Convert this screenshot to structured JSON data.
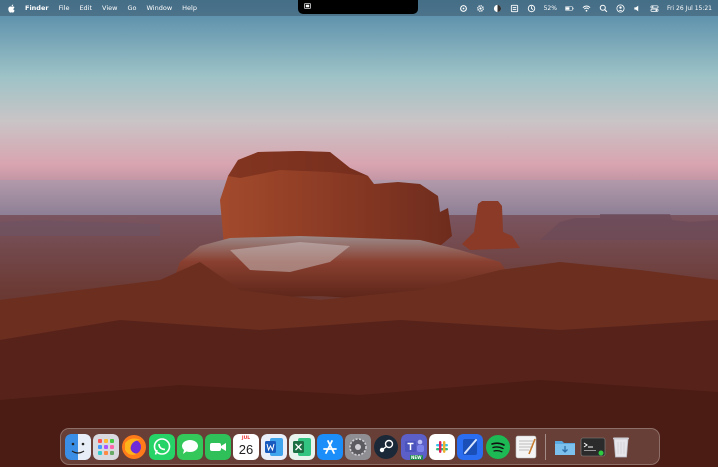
{
  "menubar": {
    "app_name": "Finder",
    "items": [
      "File",
      "Edit",
      "View",
      "Go",
      "Window",
      "Help"
    ],
    "battery_percent": "52%",
    "datetime": "Fri 26 Jul  15:21",
    "status_icons": [
      "screen-record-icon",
      "settings-icon",
      "dark-mode-icon",
      "clipboard-icon",
      "timer-icon",
      "battery-icon",
      "wifi-icon",
      "search-icon",
      "user-icon",
      "volume-icon",
      "control-center-icon"
    ]
  },
  "dock": {
    "apps": [
      {
        "name": "Finder",
        "icon": "finder-icon",
        "color": "#3a8ee6"
      },
      {
        "name": "Launchpad",
        "icon": "launchpad-icon",
        "color": "#d9d9e0"
      },
      {
        "name": "Firefox",
        "icon": "firefox-icon",
        "color": "#ff7a1a"
      },
      {
        "name": "WhatsApp",
        "icon": "whatsapp-icon",
        "color": "#25d366"
      },
      {
        "name": "Messages",
        "icon": "messages-icon",
        "color": "#34c759"
      },
      {
        "name": "FaceTime",
        "icon": "facetime-icon",
        "color": "#2fc05a"
      },
      {
        "name": "Calendar",
        "icon": "calendar-icon",
        "month": "JUL",
        "day": "26"
      },
      {
        "name": "Word",
        "icon": "word-icon",
        "color": "#185abd"
      },
      {
        "name": "Excel",
        "icon": "excel-icon",
        "color": "#1d7044"
      },
      {
        "name": "App Store",
        "icon": "app-store-icon",
        "color": "#1c8ef9"
      },
      {
        "name": "System Settings",
        "icon": "system-settings-icon",
        "color": "#8e8e93"
      },
      {
        "name": "Steam",
        "icon": "steam-icon",
        "color": "#1b2838"
      },
      {
        "name": "Teams",
        "icon": "teams-icon",
        "color": "#5b5fc7",
        "badge": "NEW"
      },
      {
        "name": "Slack",
        "icon": "slack-icon",
        "color": "#ffffff"
      },
      {
        "name": "Xcode",
        "icon": "xcode-icon",
        "color": "#2a6df0"
      },
      {
        "name": "Spotify",
        "icon": "spotify-icon",
        "color": "#1db954"
      },
      {
        "name": "TextEdit",
        "icon": "textedit-icon",
        "color": "#f4f4f4"
      }
    ],
    "stack_items": [
      {
        "name": "Downloads",
        "icon": "downloads-folder-icon",
        "color": "#5aa8e0"
      },
      {
        "name": "Terminal",
        "icon": "terminal-icon",
        "color": "#2b2b2b"
      },
      {
        "name": "Trash",
        "icon": "trash-icon",
        "color": "#e6e6ea"
      }
    ]
  }
}
